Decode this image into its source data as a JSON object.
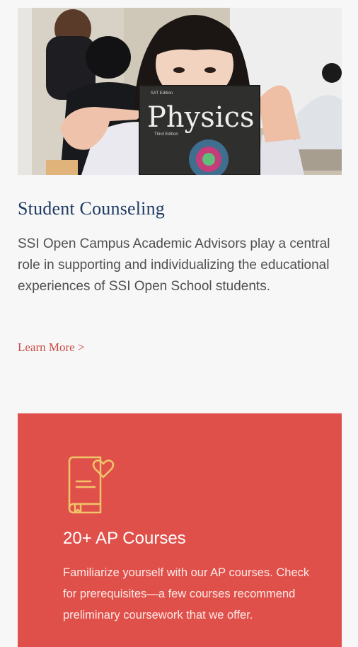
{
  "hero": {
    "book_title": "Physics",
    "book_small_top": "SAT Edition",
    "book_small_sub": "Third Edition"
  },
  "counseling": {
    "title": "Student Counseling",
    "body": "SSI Open Campus Academic Advisors play a central role in supporting and individualizing the educational experiences of SSI Open School students.",
    "link_label": "Learn More >"
  },
  "ap_card": {
    "icon": "book-heart-icon",
    "title": "20+ AP Courses",
    "text": "Familiarize yourself with our AP courses. Check for prerequisites—a few courses recommend preliminary coursework that we offer."
  },
  "colors": {
    "title_blue": "#1f3a63",
    "link_red": "#c94a43",
    "card_red": "#e0504a"
  }
}
